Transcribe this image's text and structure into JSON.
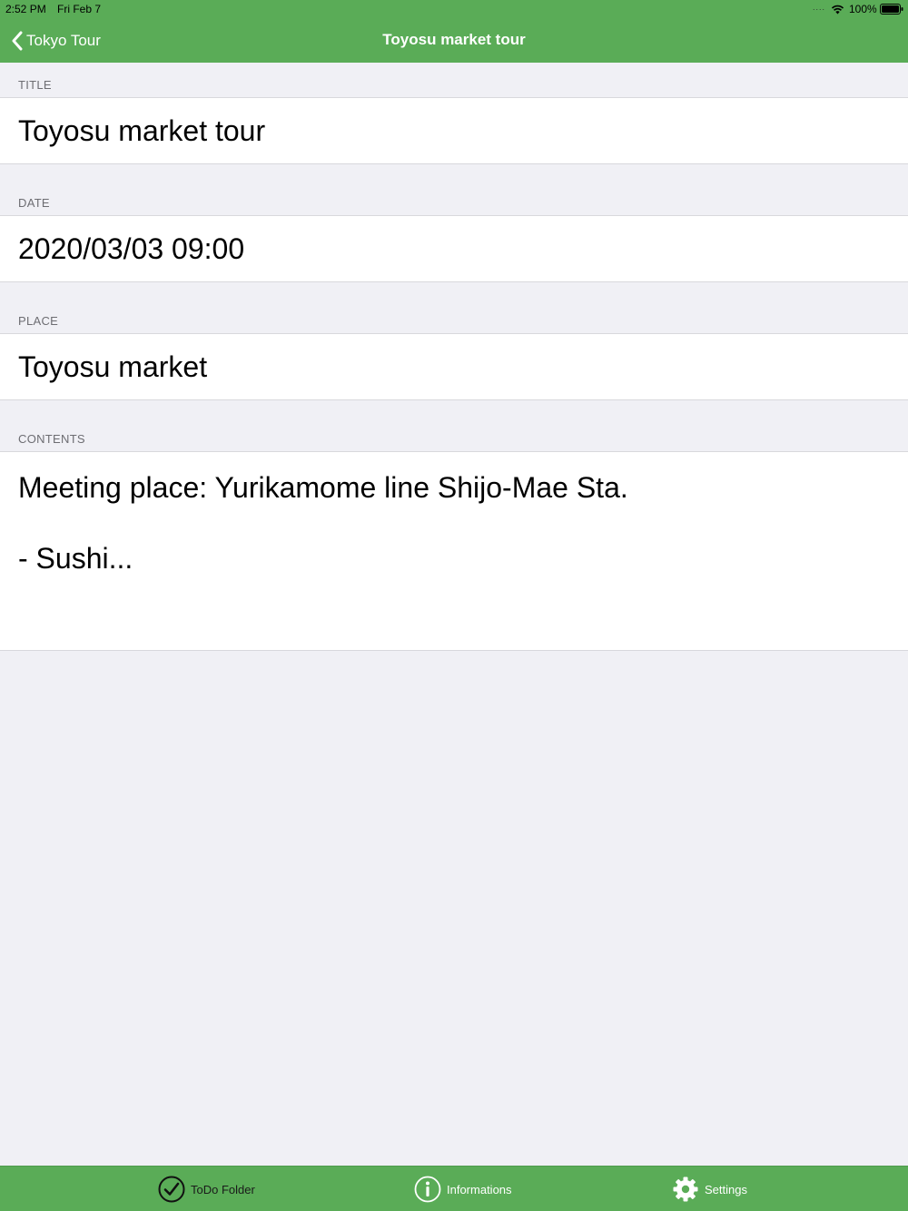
{
  "status_bar": {
    "time": "2:52 PM",
    "date": "Fri Feb 7",
    "signal_dots": "....",
    "battery_percent": "100%"
  },
  "nav": {
    "back_label": "Tokyo Tour",
    "title": "Toyosu market tour"
  },
  "form": {
    "title": {
      "header": "TITLE",
      "value": "Toyosu market tour"
    },
    "date": {
      "header": "DATE",
      "value": "2020/03/03 09:00"
    },
    "place": {
      "header": "PLACE",
      "value": "Toyosu market"
    },
    "contents": {
      "header": "CONTENTS",
      "value": "Meeting place: Yurikamome line Shijo-Mae Sta.\n\n- Sushi..."
    }
  },
  "tabbar": {
    "items": [
      {
        "label": "ToDo Folder",
        "icon": "checkmark-circle-icon"
      },
      {
        "label": "Informations",
        "icon": "info-circle-icon"
      },
      {
        "label": "Settings",
        "icon": "gear-icon"
      }
    ]
  },
  "colors": {
    "accent_green": "#5aac57",
    "background": "#f0f0f5"
  }
}
